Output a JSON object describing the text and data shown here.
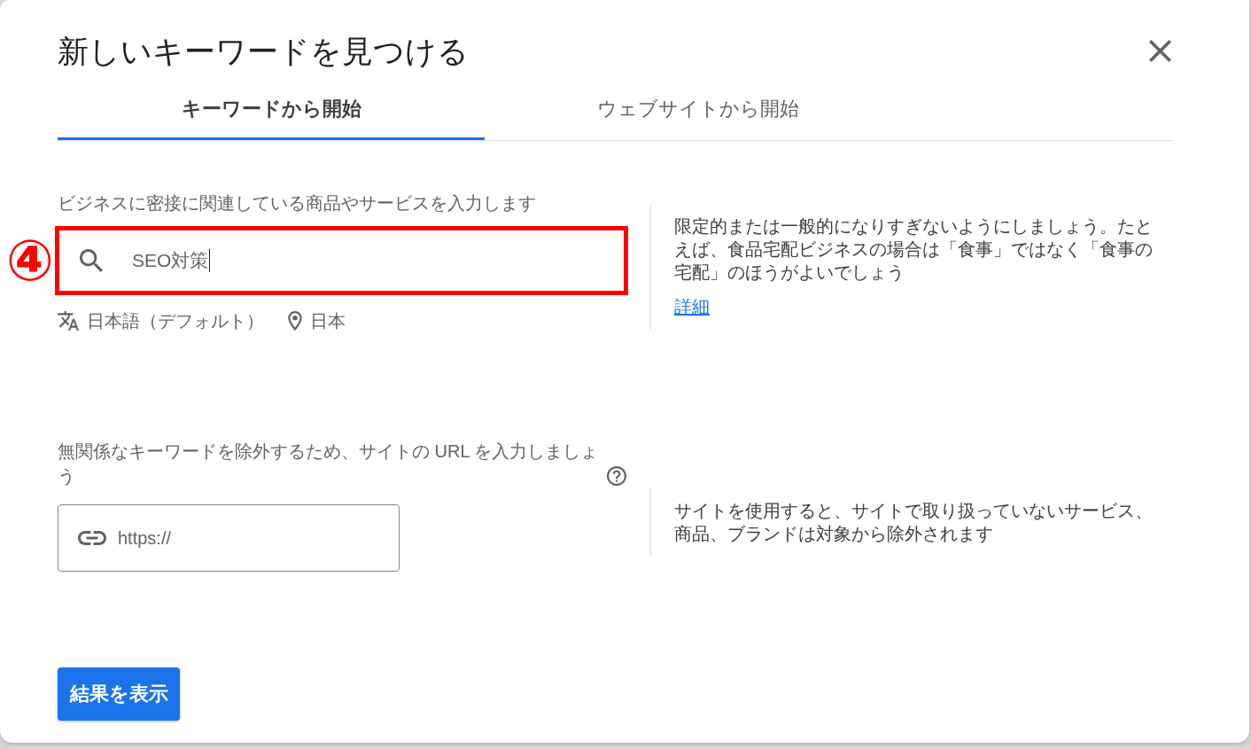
{
  "dialog": {
    "title": "新しいキーワードを見つける"
  },
  "tabs": [
    {
      "label": "キーワードから開始",
      "selected": true
    },
    {
      "label": "ウェブサイトから開始",
      "selected": false
    }
  ],
  "keyword_section": {
    "label": "ビジネスに密接に関連している商品やサービスを入力します",
    "field": {
      "value": "SEO対策",
      "focused": true,
      "highlighted": true
    },
    "annotation": {
      "label": "④"
    },
    "language": "日本語（デフォルト）",
    "location": "日本",
    "hint": "限定的または一般的になりすぎないようにしましょう。たとえば、食品宅配ビジネスの場合は「食事」ではなく「食事の宅配」のほうがよいでしょう",
    "link": "詳細"
  },
  "site_section": {
    "label": "無関係なキーワードを除外するため、サイトの URL を入力しましょう",
    "field": {
      "placeholder": "https://"
    },
    "hint": "サイトを使用すると、サイトで取り扱っていないサービス、商品、ブランドは対象から除外されます"
  },
  "submit_button": "結果を表示"
}
